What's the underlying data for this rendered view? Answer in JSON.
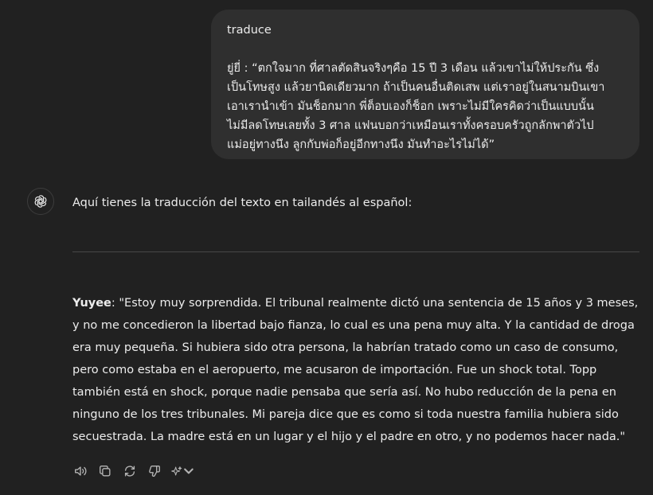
{
  "conversation": {
    "user_message": {
      "command": "traduce",
      "lines": [
        "ยู่ยี่ : “ตกใจมาก ที่ศาลตัดสินจริงๆคือ 15 ปี 3 เดือน แล้วเขาไม่ให้ประกัน ซึ่ง",
        "เป็นโทษสูง แล้วยานิดเดียวมาก ถ้าเป็นคนอื่นติดเสพ แต่เราอยู่ในสนามบินเขา",
        "เอาเรานำเข้า มันช็อกมาก พี่ต็อบเองก็ช็อก เพราะไม่มีใครคิดว่าเป็นแบบนั้น",
        "ไม่มีลดโทษเลยทั้ง 3 ศาล แฟนบอกว่าเหมือนเราทั้งครอบครัวถูกลักพาตัวไป",
        "แม่อยู่ทางนึง ลูกกับพ่อก็อยู่อีกทางนึง มันทำอะไรไม่ได้”"
      ]
    },
    "assistant_message": {
      "avatar_icon": "openai-logo-icon",
      "intro": "Aquí tienes la traducción del texto en tailandés al español:",
      "speaker": "Yuyee",
      "speaker_separator": ":",
      "body": " \"Estoy muy sorprendida. El tribunal realmente dictó una sentencia de 15 años y 3 meses, y no me concedieron la libertad bajo fianza, lo cual es una pena muy alta. Y la cantidad de droga era muy pequeña. Si hubiera sido otra persona, la habrían tratado como un caso de consumo, pero como estaba en el aeropuerto, me acusaron de importación. Fue un shock total. Topp también está en shock, porque nadie pensaba que sería así. No hubo reducción de la pena en ninguno de los tres tribunales. Mi pareja dice que es como si toda nuestra familia hubiera sido secuestrada. La madre está en un lugar y el hijo y el padre en otro, y no podemos hacer nada.\""
    },
    "actions": [
      {
        "icon": "read-aloud-icon"
      },
      {
        "icon": "copy-icon"
      },
      {
        "icon": "regenerate-icon"
      },
      {
        "icon": "thumbs-down-icon"
      },
      {
        "icon": "sparkle-model-icon"
      }
    ]
  },
  "colors": {
    "background": "#212121",
    "bubble": "#2f2f2f",
    "text": "#ececec",
    "icon": "#b4b4b4",
    "divider": "#474747"
  }
}
